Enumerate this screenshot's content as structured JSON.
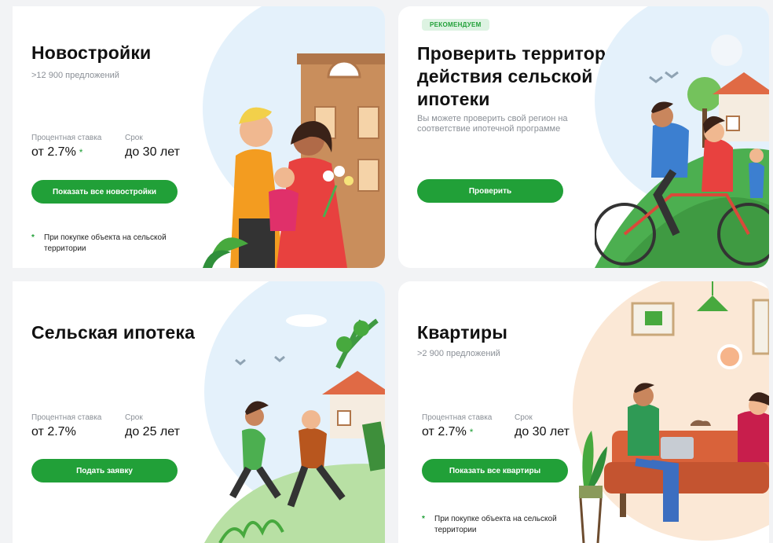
{
  "cards": {
    "new_buildings": {
      "title": "Новостройки",
      "subtitle": ">12 900 предложений",
      "rate_label": "Процентная ставка",
      "rate_value": "от 2.7%",
      "rate_star": "*",
      "term_label": "Срок",
      "term_value": "до 30 лет",
      "button": "Показать все новостройки",
      "footnote_star": "*",
      "footnote": "При покупке объекта на сельской территории"
    },
    "check_territory": {
      "badge": "РЕКОМЕНДУЕМ",
      "title": "Проверить территорию действия сельской ипотеки",
      "subtitle": "Вы можете проверить свой регион на соответствие ипотечной программе",
      "button": "Проверить"
    },
    "rural_mortgage": {
      "title": "Сельская ипотека",
      "rate_label": "Процентная ставка",
      "rate_value": "от 2.7%",
      "term_label": "Срок",
      "term_value": "до 25 лет",
      "button": "Подать заявку"
    },
    "apartments": {
      "title": "Квартиры",
      "subtitle": ">2 900 предложений",
      "rate_label": "Процентная ставка",
      "rate_value": "от 2.7%",
      "rate_star": "*",
      "term_label": "Срок",
      "term_value": "до 30 лет",
      "button": "Показать все квартиры",
      "footnote_star": "*",
      "footnote": "При покупке объекта на сельской территории"
    }
  },
  "colors": {
    "accent": "#21a038",
    "badge_bg": "#ddf3e2",
    "muted_text": "#8a8f96"
  }
}
